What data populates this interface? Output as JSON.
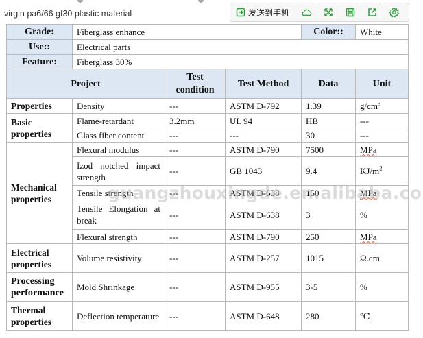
{
  "caption": "virgin pa6/66  gf30 plastic material",
  "toolbar": {
    "send_label": "发送到手机",
    "icons": [
      "send-to-phone-icon",
      "cloud-icon",
      "expand-icon",
      "save-icon",
      "share-icon",
      "settings-icon"
    ],
    "accent_color": "#2e9e3e"
  },
  "spec": {
    "grade_label": "Grade:",
    "grade_value": "Fiberglass enhance",
    "color_label": "Color::",
    "color_value": "White",
    "use_label": "Use::",
    "use_value": "Electrical parts",
    "feature_label": "Feature:",
    "feature_value": "Fiberglass 30%"
  },
  "headers": {
    "project": "Project",
    "test_condition": "Test condition",
    "test_method": "Test Method",
    "data": "Data",
    "unit": "Unit"
  },
  "rows": [
    {
      "category": "Properties",
      "item": "Density",
      "condition": "---",
      "method": "ASTM D-792",
      "data": "1.39",
      "unit": "g/cm",
      "unit_sup": "3"
    },
    {
      "category": "Basic properties",
      "item": "Flame-retardant",
      "condition": "3.2mm",
      "method": "UL 94",
      "data": "HB",
      "unit": "---"
    },
    {
      "item": "Glass fiber content",
      "condition": "---",
      "method": "---",
      "data": "30",
      "unit": "---"
    },
    {
      "category": "Mechanical properties",
      "item": "Flexural modulus",
      "condition": "---",
      "method": "ASTM D-790",
      "data": "7500",
      "unit": "MPa"
    },
    {
      "item": "Izod notched impact strength",
      "condition": "---",
      "method": "GB 1043",
      "data": "9.4",
      "unit": "KJ/m",
      "unit_sup": "2"
    },
    {
      "item": "Tensile strength",
      "condition": "---",
      "method": "ASTM D-638",
      "data": "150",
      "unit": "MPa"
    },
    {
      "item": "Tensile Elongation at break",
      "condition": "---",
      "method": "ASTM D-638",
      "data": "3",
      "unit": "%"
    },
    {
      "item": "Flexural strength",
      "condition": "---",
      "method": "ASTM D-790",
      "data": "250",
      "unit": "MPa"
    },
    {
      "category": "Electrical properties",
      "item": "Volume resistivity",
      "condition": "---",
      "method": "ASTM D-257",
      "data": "1015",
      "unit": "Ω.cm"
    },
    {
      "category": "Processing performance",
      "item": "Mold Shrinkage",
      "condition": "---",
      "method": "ASTM D-955",
      "data": "3-5",
      "unit": "%"
    },
    {
      "category": "Thermal properties",
      "item": "Deflection temperature",
      "condition": "---",
      "method": "ASTM D-648",
      "data": "280",
      "unit": "℃"
    }
  ],
  "watermark": "guangzhouxingde.en.alibaba.com"
}
